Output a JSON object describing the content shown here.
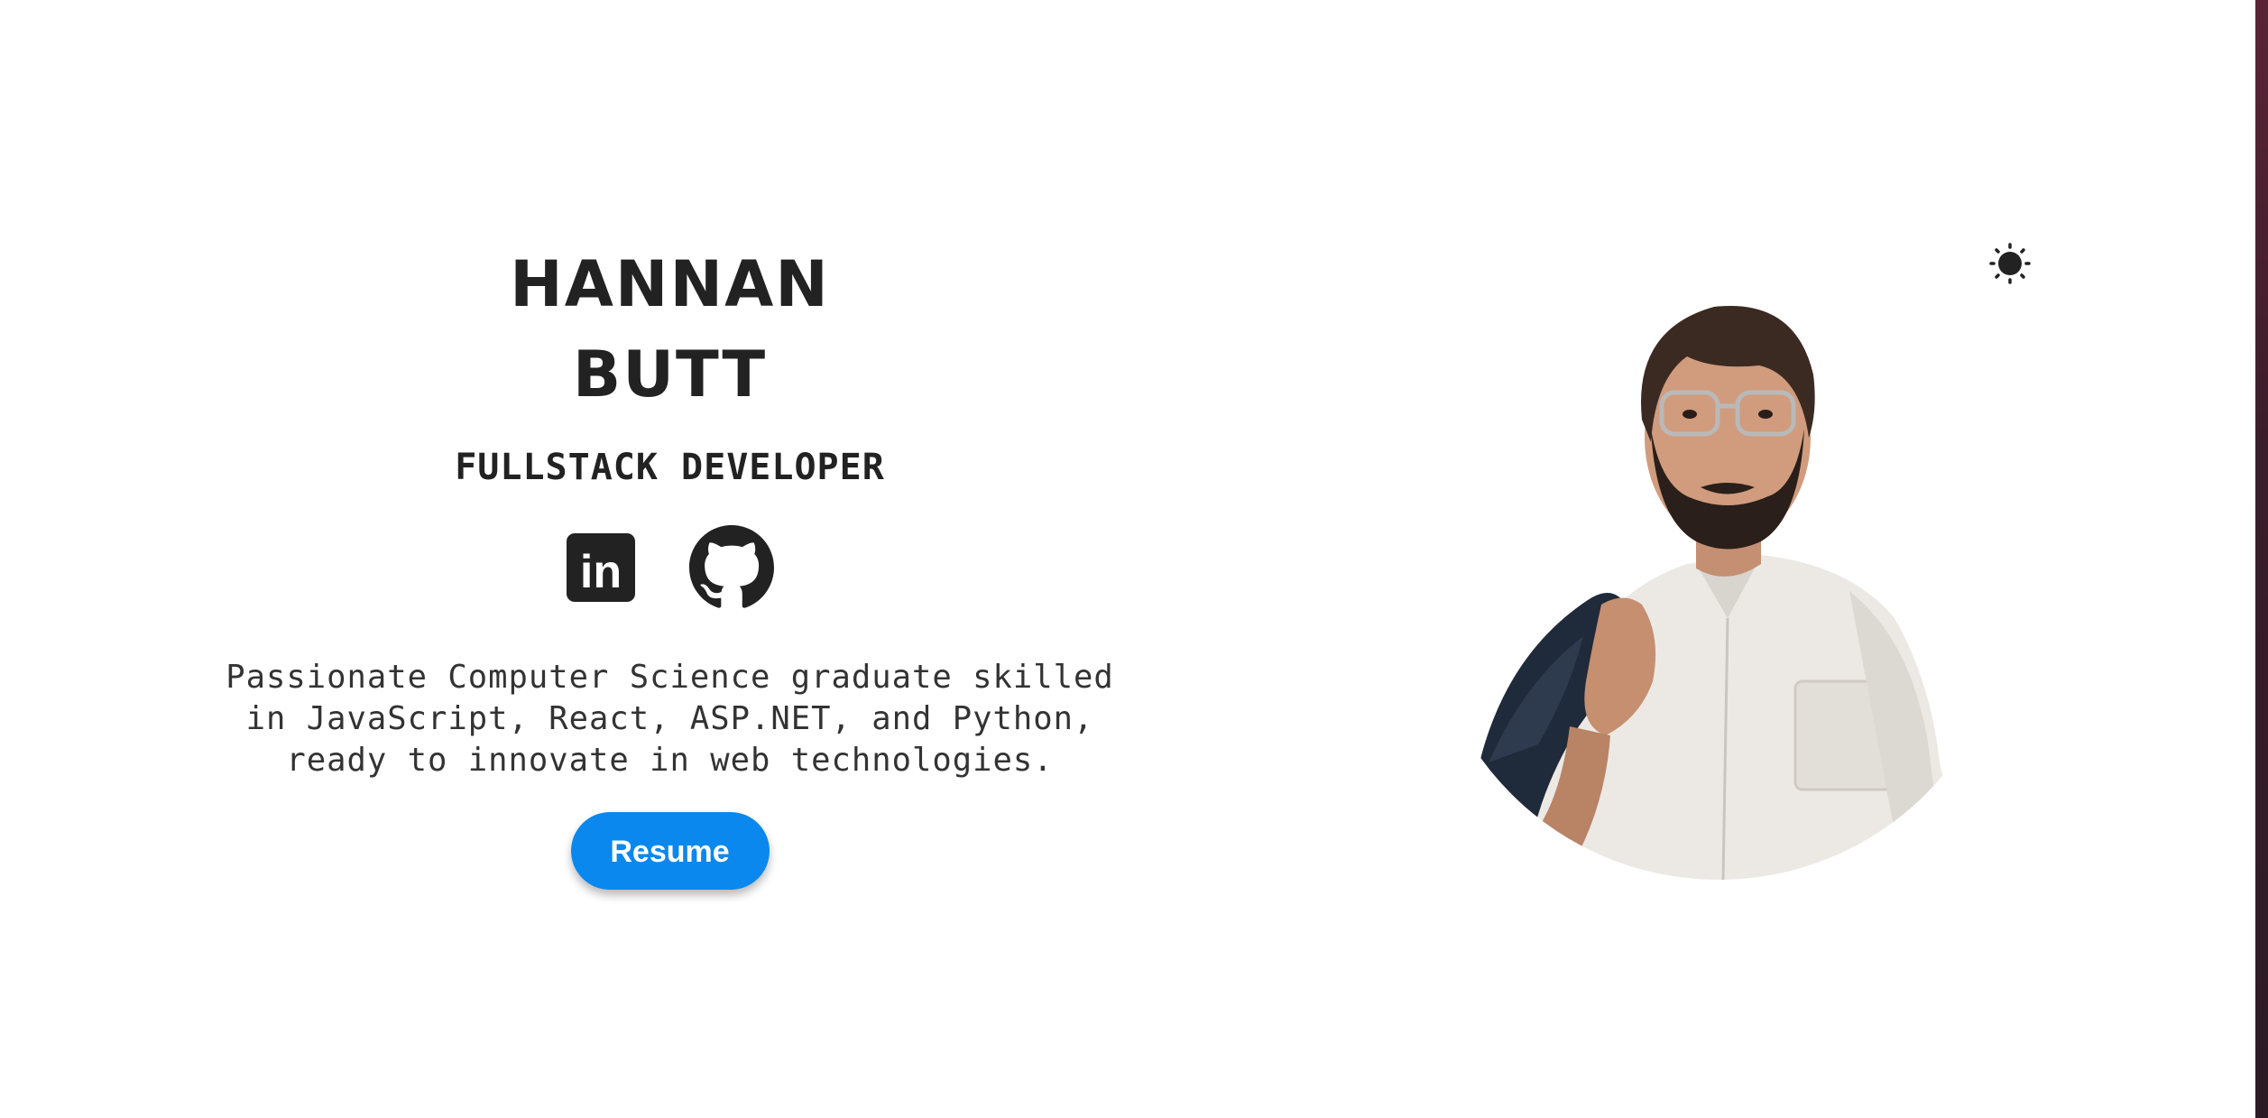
{
  "hero": {
    "name_first": "HANNAN",
    "name_last": "BUTT",
    "role": "FULLSTACK DEVELOPER",
    "bio": "Passionate Computer Science graduate skilled in JavaScript, React, ASP.NET, and Python, ready to innovate in web technologies.",
    "resume_label": "Resume"
  },
  "socials": [
    {
      "icon": "linkedin-icon",
      "label": "in"
    },
    {
      "icon": "github-icon"
    }
  ],
  "theme_toggle": {
    "icon": "sun-icon"
  },
  "colors": {
    "text": "#222222",
    "accent": "#0a88ee",
    "background": "#ffffff",
    "edge": "#3a1d2a"
  }
}
